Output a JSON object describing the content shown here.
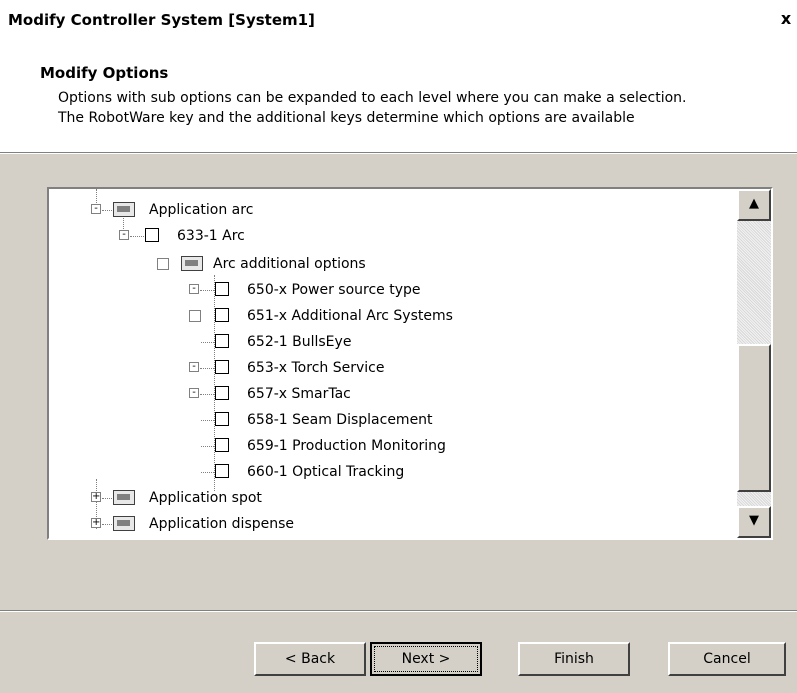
{
  "window": {
    "title": "Modify Controller System [System1]",
    "close_label": "x"
  },
  "header": {
    "title": "Modify Options",
    "description": "Options with sub options can be expanded to each level where you can make a selection. The RobotWare key and the additional keys determine which options are available"
  },
  "tree": {
    "items": [
      {
        "label": "Application arc",
        "expander": "-",
        "type": "folder"
      },
      {
        "label": "633-1 Arc",
        "expander": "-",
        "type": "checkbox"
      },
      {
        "label": "Arc additional options",
        "expander": "",
        "type": "folder"
      },
      {
        "label": "650-x Power source type",
        "expander": "-",
        "type": "checkbox"
      },
      {
        "label": "651-x Additional Arc Systems",
        "expander": "",
        "type": "checkbox"
      },
      {
        "label": "652-1 BullsEye",
        "expander": "",
        "type": "checkbox"
      },
      {
        "label": "653-x Torch Service",
        "expander": "-",
        "type": "checkbox"
      },
      {
        "label": "657-x SmarTac",
        "expander": "-",
        "type": "checkbox"
      },
      {
        "label": "658-1 Seam Displacement",
        "expander": "",
        "type": "checkbox"
      },
      {
        "label": "659-1 Production Monitoring",
        "expander": "",
        "type": "checkbox"
      },
      {
        "label": "660-1 Optical Tracking",
        "expander": "",
        "type": "checkbox"
      },
      {
        "label": "Application spot",
        "expander": "+",
        "type": "folder"
      },
      {
        "label": "Application dispense",
        "expander": "+",
        "type": "folder"
      }
    ],
    "scroll_up": "▲",
    "scroll_down": "▼"
  },
  "buttons": {
    "back": "< Back",
    "next": "Next >",
    "finish": "Finish",
    "cancel": "Cancel"
  }
}
